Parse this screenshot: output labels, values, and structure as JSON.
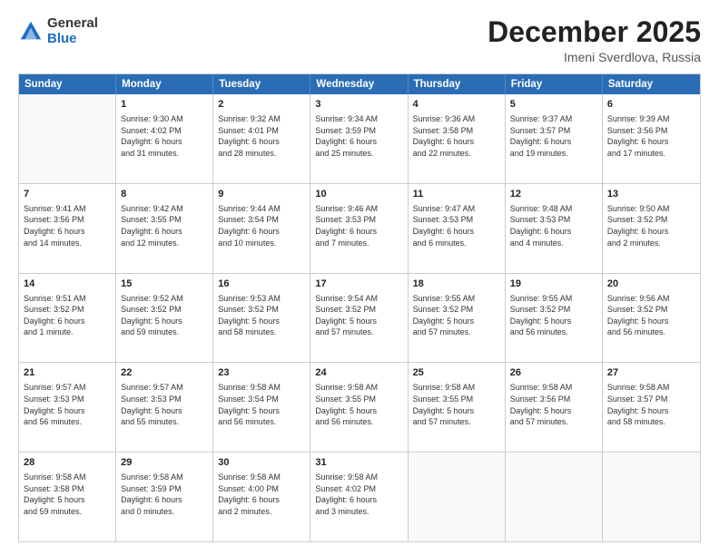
{
  "logo": {
    "general": "General",
    "blue": "Blue"
  },
  "title": "December 2025",
  "subtitle": "Imeni Sverdlova, Russia",
  "header_days": [
    "Sunday",
    "Monday",
    "Tuesday",
    "Wednesday",
    "Thursday",
    "Friday",
    "Saturday"
  ],
  "weeks": [
    [
      {
        "day": "",
        "info": ""
      },
      {
        "day": "1",
        "info": "Sunrise: 9:30 AM\nSunset: 4:02 PM\nDaylight: 6 hours\nand 31 minutes."
      },
      {
        "day": "2",
        "info": "Sunrise: 9:32 AM\nSunset: 4:01 PM\nDaylight: 6 hours\nand 28 minutes."
      },
      {
        "day": "3",
        "info": "Sunrise: 9:34 AM\nSunset: 3:59 PM\nDaylight: 6 hours\nand 25 minutes."
      },
      {
        "day": "4",
        "info": "Sunrise: 9:36 AM\nSunset: 3:58 PM\nDaylight: 6 hours\nand 22 minutes."
      },
      {
        "day": "5",
        "info": "Sunrise: 9:37 AM\nSunset: 3:57 PM\nDaylight: 6 hours\nand 19 minutes."
      },
      {
        "day": "6",
        "info": "Sunrise: 9:39 AM\nSunset: 3:56 PM\nDaylight: 6 hours\nand 17 minutes."
      }
    ],
    [
      {
        "day": "7",
        "info": "Sunrise: 9:41 AM\nSunset: 3:56 PM\nDaylight: 6 hours\nand 14 minutes."
      },
      {
        "day": "8",
        "info": "Sunrise: 9:42 AM\nSunset: 3:55 PM\nDaylight: 6 hours\nand 12 minutes."
      },
      {
        "day": "9",
        "info": "Sunrise: 9:44 AM\nSunset: 3:54 PM\nDaylight: 6 hours\nand 10 minutes."
      },
      {
        "day": "10",
        "info": "Sunrise: 9:46 AM\nSunset: 3:53 PM\nDaylight: 6 hours\nand 7 minutes."
      },
      {
        "day": "11",
        "info": "Sunrise: 9:47 AM\nSunset: 3:53 PM\nDaylight: 6 hours\nand 6 minutes."
      },
      {
        "day": "12",
        "info": "Sunrise: 9:48 AM\nSunset: 3:53 PM\nDaylight: 6 hours\nand 4 minutes."
      },
      {
        "day": "13",
        "info": "Sunrise: 9:50 AM\nSunset: 3:52 PM\nDaylight: 6 hours\nand 2 minutes."
      }
    ],
    [
      {
        "day": "14",
        "info": "Sunrise: 9:51 AM\nSunset: 3:52 PM\nDaylight: 6 hours\nand 1 minute."
      },
      {
        "day": "15",
        "info": "Sunrise: 9:52 AM\nSunset: 3:52 PM\nDaylight: 5 hours\nand 59 minutes."
      },
      {
        "day": "16",
        "info": "Sunrise: 9:53 AM\nSunset: 3:52 PM\nDaylight: 5 hours\nand 58 minutes."
      },
      {
        "day": "17",
        "info": "Sunrise: 9:54 AM\nSunset: 3:52 PM\nDaylight: 5 hours\nand 57 minutes."
      },
      {
        "day": "18",
        "info": "Sunrise: 9:55 AM\nSunset: 3:52 PM\nDaylight: 5 hours\nand 57 minutes."
      },
      {
        "day": "19",
        "info": "Sunrise: 9:55 AM\nSunset: 3:52 PM\nDaylight: 5 hours\nand 56 minutes."
      },
      {
        "day": "20",
        "info": "Sunrise: 9:56 AM\nSunset: 3:52 PM\nDaylight: 5 hours\nand 56 minutes."
      }
    ],
    [
      {
        "day": "21",
        "info": "Sunrise: 9:57 AM\nSunset: 3:53 PM\nDaylight: 5 hours\nand 56 minutes."
      },
      {
        "day": "22",
        "info": "Sunrise: 9:57 AM\nSunset: 3:53 PM\nDaylight: 5 hours\nand 55 minutes."
      },
      {
        "day": "23",
        "info": "Sunrise: 9:58 AM\nSunset: 3:54 PM\nDaylight: 5 hours\nand 56 minutes."
      },
      {
        "day": "24",
        "info": "Sunrise: 9:58 AM\nSunset: 3:55 PM\nDaylight: 5 hours\nand 56 minutes."
      },
      {
        "day": "25",
        "info": "Sunrise: 9:58 AM\nSunset: 3:55 PM\nDaylight: 5 hours\nand 57 minutes."
      },
      {
        "day": "26",
        "info": "Sunrise: 9:58 AM\nSunset: 3:56 PM\nDaylight: 5 hours\nand 57 minutes."
      },
      {
        "day": "27",
        "info": "Sunrise: 9:58 AM\nSunset: 3:57 PM\nDaylight: 5 hours\nand 58 minutes."
      }
    ],
    [
      {
        "day": "28",
        "info": "Sunrise: 9:58 AM\nSunset: 3:58 PM\nDaylight: 5 hours\nand 59 minutes."
      },
      {
        "day": "29",
        "info": "Sunrise: 9:58 AM\nSunset: 3:59 PM\nDaylight: 6 hours\nand 0 minutes."
      },
      {
        "day": "30",
        "info": "Sunrise: 9:58 AM\nSunset: 4:00 PM\nDaylight: 6 hours\nand 2 minutes."
      },
      {
        "day": "31",
        "info": "Sunrise: 9:58 AM\nSunset: 4:02 PM\nDaylight: 6 hours\nand 3 minutes."
      },
      {
        "day": "",
        "info": ""
      },
      {
        "day": "",
        "info": ""
      },
      {
        "day": "",
        "info": ""
      }
    ]
  ]
}
